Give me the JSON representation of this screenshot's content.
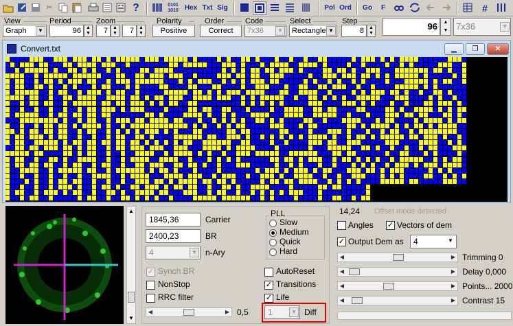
{
  "toolbar": {
    "icons": [
      "open-icon",
      "save-as-icon",
      "save-icon",
      "cut-icon",
      "copy-icon",
      "paste-icon",
      "print-icon",
      "scan-icon",
      "help-icon",
      "binary-icon",
      "binary-bits-icon",
      "hex-icon",
      "txt-icon",
      "sig-icon",
      "view1-icon",
      "view2-icon",
      "view3-icon",
      "view4-icon",
      "barcode-icon",
      "pol-icon",
      "ord-icon",
      "go-icon",
      "find-icon",
      "sync-icon",
      "back-icon",
      "forward-icon",
      "layout-icon",
      "grid-icon",
      "columns-icon"
    ],
    "bits_label": "0101\n1010",
    "hex_label": "Hex",
    "txt_label": "Txt",
    "sig_label": "Sig",
    "pol_label": "Pol",
    "ord_label": "Ord",
    "go_label": "Go",
    "find_label": "F"
  },
  "params": {
    "view_label": "View",
    "view_value": "Graph",
    "period_label": "Period",
    "period_value": "96",
    "zoom_label": "Zoom",
    "zoom_x": "7",
    "zoom_y": "7",
    "polarity_label": "Polarity",
    "polarity_value": "Positive",
    "order_label": "Order",
    "order_value": "Correct",
    "code_label": "Code",
    "code_value": "7x36",
    "select_label": "Select",
    "select_value": "Rectangle",
    "step_label": "Step",
    "step_value": "8",
    "big_value": "96",
    "big_select": "7x36"
  },
  "window": {
    "title": "Convert.txt",
    "colors": {
      "one": "#ffff00",
      "zero": "#0000ff",
      "background": "#000000"
    }
  },
  "demod": {
    "carrier_value": "1845,36",
    "carrier_label": "Carrier",
    "br_value": "2400,23",
    "br_label": "BR",
    "nary_value": "4",
    "nary_label": "n-Ary",
    "synch_br": "Synch BR",
    "nonstop": "NonStop",
    "rrc": "RRC filter",
    "slider_value": "0,5",
    "pll_title": "PLL",
    "pll_options": [
      "Slow",
      "Medium",
      "Quick",
      "Hard"
    ],
    "pll_selected": "Medium",
    "autoreset": "AutoReset",
    "transitions": "Transitions",
    "life": "Life",
    "diff_value": "1",
    "diff_label": "Diff"
  },
  "right": {
    "offset_value": "14,24",
    "offset_status": "Offset mode detected",
    "angles": "Angles",
    "vectors": "Vectors of dem",
    "output_dem": "Output Dem as",
    "output_value": "4",
    "trimming": "Trimming 0",
    "delay": "Delay  0,000",
    "points": "Points... 2000",
    "contrast": "Contrast 15"
  }
}
